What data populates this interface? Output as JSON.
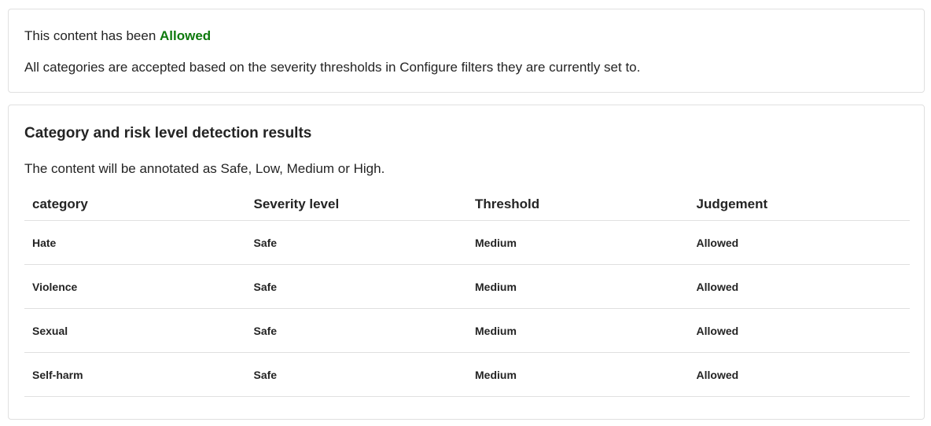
{
  "status": {
    "prefix": "This content has been",
    "result": "Allowed",
    "result_color": "#0e7a0d",
    "description": "All categories are accepted based on the severity thresholds in Configure filters they are currently set to."
  },
  "results": {
    "title": "Category and risk level detection results",
    "description": "The content will be annotated as Safe, Low, Medium or High.",
    "columns": [
      "category",
      "Severity level",
      "Threshold",
      "Judgement"
    ],
    "rows": [
      {
        "category": "Hate",
        "severity": "Safe",
        "threshold": "Medium",
        "judgement": "Allowed"
      },
      {
        "category": "Violence",
        "severity": "Safe",
        "threshold": "Medium",
        "judgement": "Allowed"
      },
      {
        "category": "Sexual",
        "severity": "Safe",
        "threshold": "Medium",
        "judgement": "Allowed"
      },
      {
        "category": "Self-harm",
        "severity": "Safe",
        "threshold": "Medium",
        "judgement": "Allowed"
      }
    ]
  }
}
